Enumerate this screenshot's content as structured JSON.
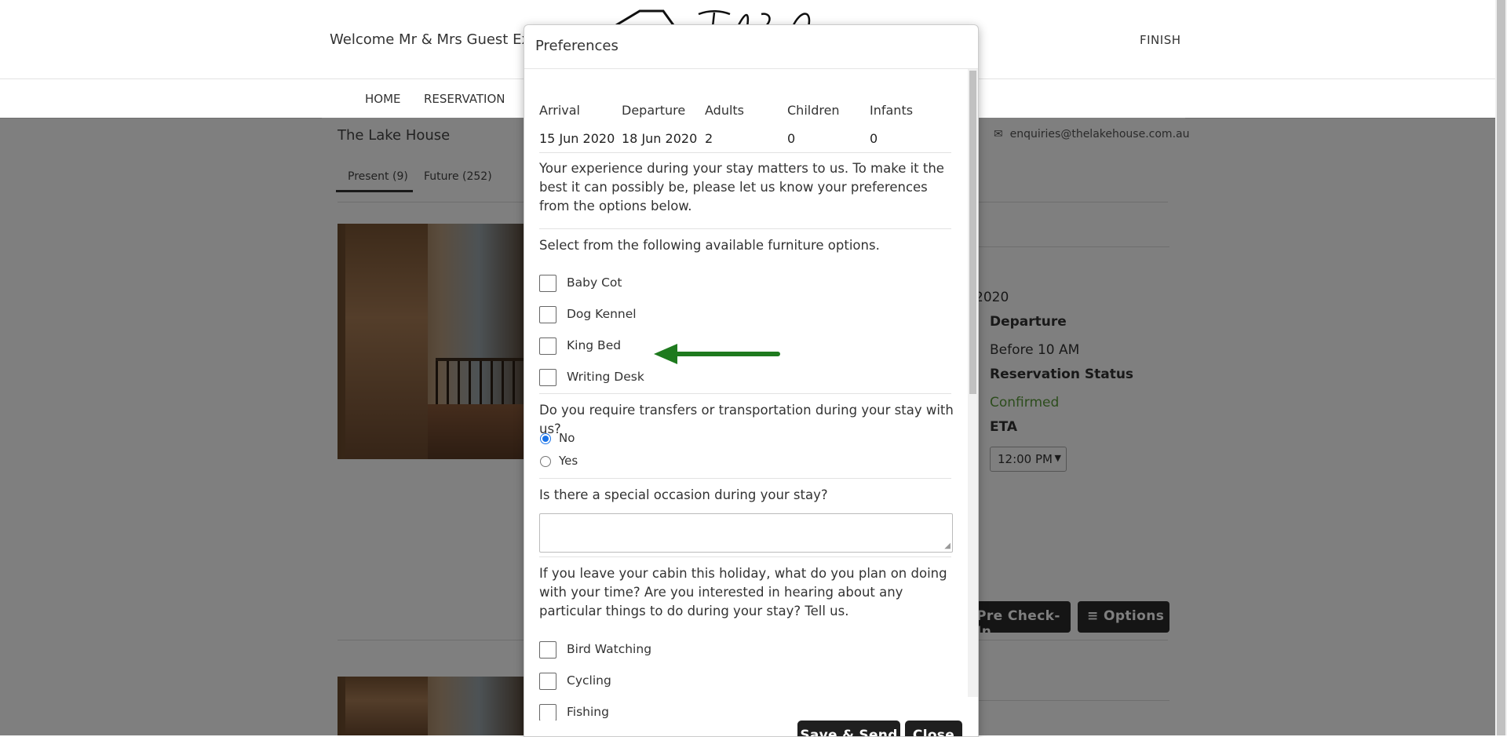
{
  "header": {
    "welcome": "Welcome Mr & Mrs Guest Exa",
    "finish": "FINISH",
    "nav": [
      "HOME",
      "RESERVATION"
    ]
  },
  "page": {
    "property_name": "The Lake House",
    "email": "enquiries@thelakehouse.com.au",
    "tabs": [
      "Present (9)",
      "Future (252)"
    ],
    "date_fragment": "2020",
    "departure_label": "Departure",
    "departure_value": "Before 10 AM",
    "status_label": "Reservation Status",
    "status_value": "Confirmed",
    "eta_label": "ETA",
    "eta_value": "12:00 PM",
    "precheckin_label": "Pre Check-In",
    "options_label": "Options",
    "colors": {
      "confirmed": "#5a9a3a",
      "dark_button": "#2b2b2b"
    }
  },
  "modal": {
    "title": "Preferences",
    "headers": [
      "Arrival",
      "Departure",
      "Adults",
      "Children",
      "Infants"
    ],
    "values": [
      "15 Jun 2020",
      "18 Jun 2020",
      "2",
      "0",
      "0"
    ],
    "intro": "Your experience during your stay matters to us. To make it the best it can possibly be, please let us know your preferences from the options below.",
    "furniture_prompt": "Select from the following available furniture options.",
    "furniture_options": [
      {
        "label": "Baby Cot",
        "checked": false
      },
      {
        "label": "Dog Kennel",
        "checked": false
      },
      {
        "label": "King Bed",
        "checked": false
      },
      {
        "label": "Writing Desk",
        "checked": false
      }
    ],
    "transfer_question": "Do you require transfers or transportation during your stay with us?",
    "transfer_options": [
      {
        "label": "No",
        "selected": true
      },
      {
        "label": "Yes",
        "selected": false
      }
    ],
    "occasion_question": "Is there a special occasion during your stay?",
    "occasion_value": "",
    "activities_prompt": "If you leave your cabin this holiday, what do you plan on doing with your time? Are you interested in hearing about any particular things to do during your stay? Tell us.",
    "activity_options": [
      {
        "label": "Bird Watching",
        "checked": false
      },
      {
        "label": "Cycling",
        "checked": false
      },
      {
        "label": "Fishing",
        "checked": false
      }
    ],
    "save_label": "Save & Send",
    "close_label": "Close",
    "arrow_color": "#1e7a1e"
  }
}
